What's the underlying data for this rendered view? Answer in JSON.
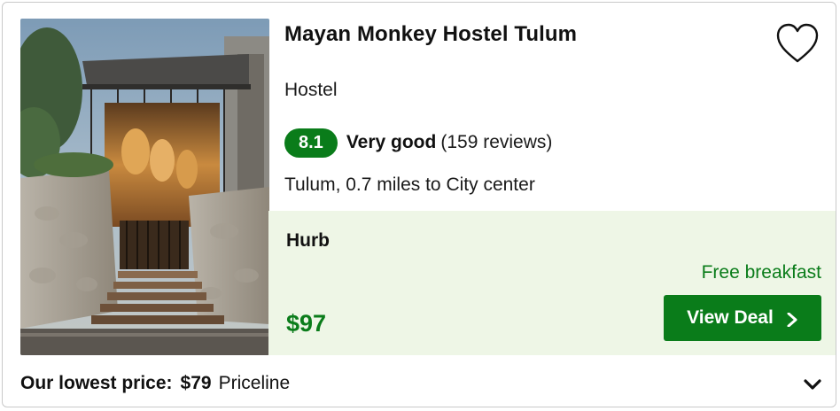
{
  "hotel": {
    "name": "Mayan Monkey Hostel Tulum",
    "type": "Hostel",
    "rating_score": "8.1",
    "rating_label": "Very good",
    "reviews": "(159 reviews)",
    "location": "Tulum, 0.7 miles to City center",
    "photo_icon": "hostel-photo"
  },
  "deal": {
    "provider": "Hurb",
    "perk": "Free breakfast",
    "price": "$97",
    "button_label": "View Deal"
  },
  "footer": {
    "lowest_label": "Our lowest price:",
    "lowest_price": "$79",
    "lowest_site": "Priceline"
  },
  "colors": {
    "accent_green": "#0a7c1a",
    "deal_background": "#eef6e6"
  }
}
